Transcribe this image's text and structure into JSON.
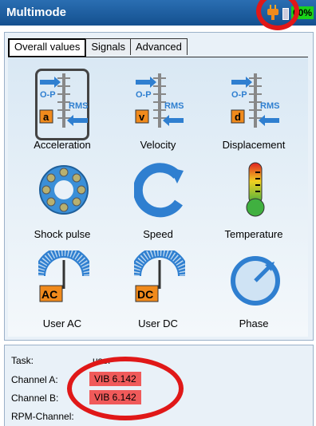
{
  "header": {
    "title": "Multimode",
    "battery_text": "00%"
  },
  "tabs": [
    {
      "label": "Overall values",
      "active": true
    },
    {
      "label": "Signals",
      "active": false
    },
    {
      "label": "Advanced",
      "active": false
    }
  ],
  "measurements": [
    {
      "label": "Acceleration",
      "icon": "acceleration-icon",
      "badge": "a"
    },
    {
      "label": "Velocity",
      "icon": "velocity-icon",
      "badge": "v"
    },
    {
      "label": "Displacement",
      "icon": "displacement-icon",
      "badge": "d"
    },
    {
      "label": "Shock pulse",
      "icon": "shock-pulse-icon"
    },
    {
      "label": "Speed",
      "icon": "speed-icon"
    },
    {
      "label": "Temperature",
      "icon": "temperature-icon"
    },
    {
      "label": "User AC",
      "icon": "user-ac-icon",
      "badge": "AC"
    },
    {
      "label": "User DC",
      "icon": "user-dc-icon",
      "badge": "DC"
    },
    {
      "label": "Phase",
      "icon": "phase-icon"
    }
  ],
  "icon_text": {
    "op": "O-P",
    "rms": "RMS"
  },
  "info": {
    "task_label": "Task:",
    "task_value": "user",
    "channel_a_label": "Channel A:",
    "channel_a_value": "VIB 6.142",
    "channel_b_label": "Channel B:",
    "channel_b_value": "VIB 6.142",
    "rpm_label": "RPM-Channel:"
  },
  "colors": {
    "header": "#1a5ea3",
    "badge": "#f08a1c",
    "highlight": "#f05a5a",
    "annotation": "#e01818"
  }
}
